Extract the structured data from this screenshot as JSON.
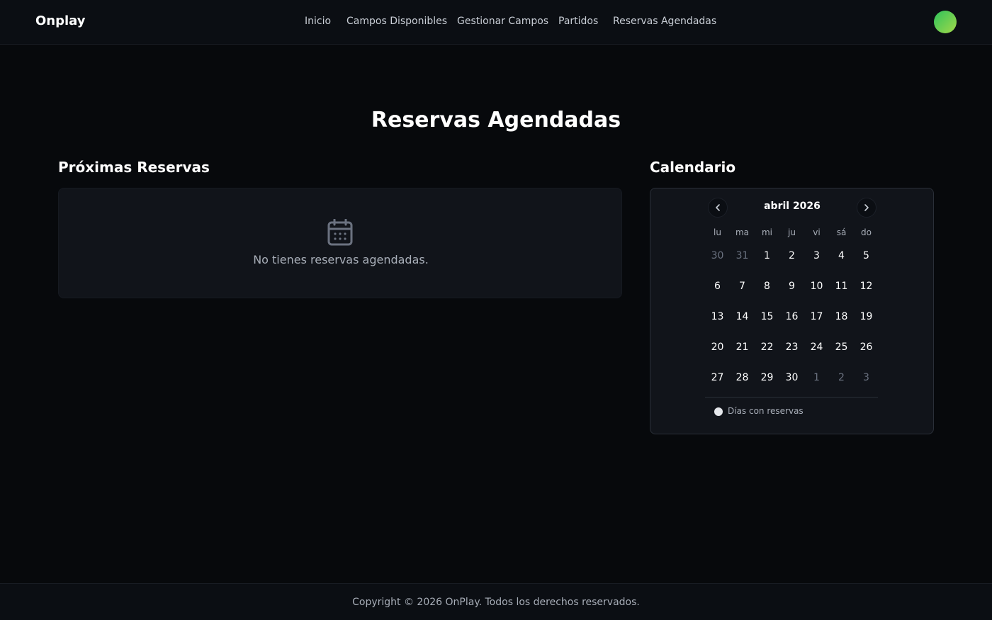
{
  "header": {
    "brand": "Onplay",
    "nav": [
      "Inicio",
      "Campos Disponibles",
      "Gestionar Campos",
      "Partidos",
      "Reservas Agendadas"
    ]
  },
  "main": {
    "title": "Reservas Agendadas",
    "upcoming": {
      "title": "Próximas Reservas",
      "empty_icon": "calendar-icon",
      "empty_text": "No tienes reservas agendadas."
    },
    "calendar": {
      "title": "Calendario",
      "month_label": "abril 2026",
      "weekdays": [
        "lu",
        "ma",
        "mi",
        "ju",
        "vi",
        "sá",
        "do"
      ],
      "weeks": [
        [
          {
            "d": "30",
            "muted": true
          },
          {
            "d": "31",
            "muted": true
          },
          {
            "d": "1"
          },
          {
            "d": "2"
          },
          {
            "d": "3"
          },
          {
            "d": "4"
          },
          {
            "d": "5"
          }
        ],
        [
          {
            "d": "6"
          },
          {
            "d": "7"
          },
          {
            "d": "8"
          },
          {
            "d": "9"
          },
          {
            "d": "10"
          },
          {
            "d": "11"
          },
          {
            "d": "12"
          }
        ],
        [
          {
            "d": "13"
          },
          {
            "d": "14"
          },
          {
            "d": "15"
          },
          {
            "d": "16"
          },
          {
            "d": "17"
          },
          {
            "d": "18"
          },
          {
            "d": "19"
          }
        ],
        [
          {
            "d": "20"
          },
          {
            "d": "21"
          },
          {
            "d": "22"
          },
          {
            "d": "23"
          },
          {
            "d": "24"
          },
          {
            "d": "25"
          },
          {
            "d": "26"
          }
        ],
        [
          {
            "d": "27"
          },
          {
            "d": "28"
          },
          {
            "d": "29"
          },
          {
            "d": "30"
          },
          {
            "d": "1",
            "muted": true
          },
          {
            "d": "2",
            "muted": true
          },
          {
            "d": "3",
            "muted": true
          }
        ]
      ],
      "prev_icon": "chevron-left-icon",
      "next_icon": "chevron-right-icon",
      "legend": "Días con reservas"
    }
  },
  "footer": {
    "text": "Copyright © 2026 OnPlay. Todos los derechos reservados."
  },
  "colors": {
    "background": "#07090c",
    "card": "#11141a",
    "avatar_gradient_start": "#2fc35b",
    "avatar_gradient_end": "#a3d84a"
  }
}
